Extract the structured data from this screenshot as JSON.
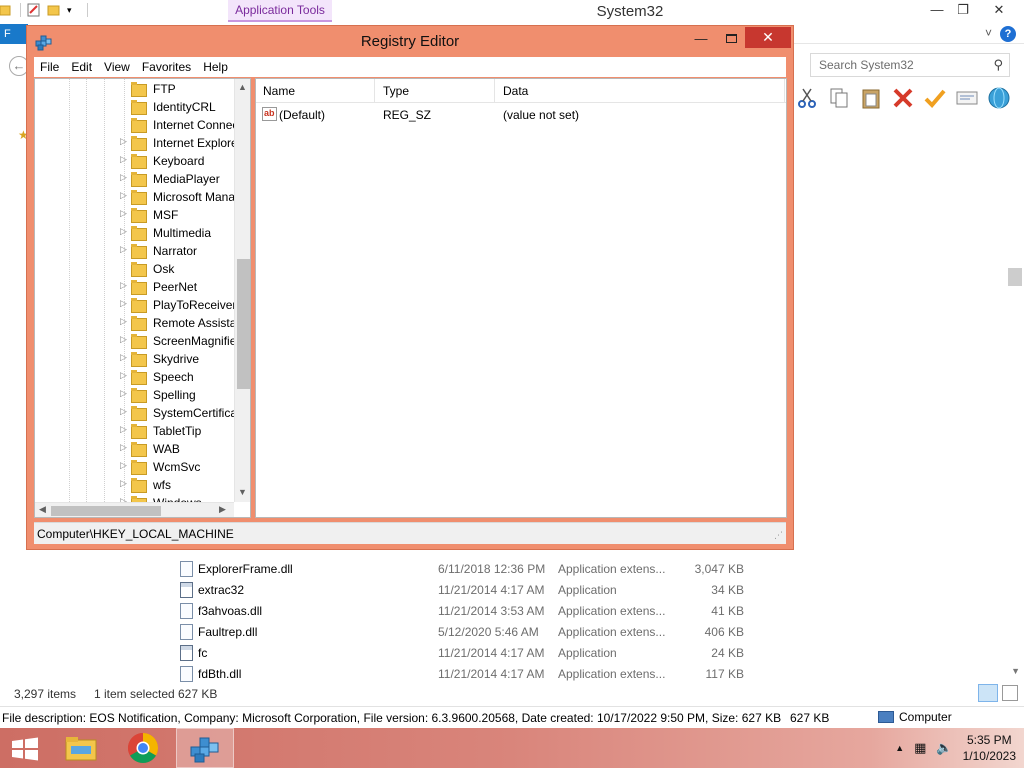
{
  "explorer": {
    "title": "System32",
    "app_tools_tab": "Application Tools",
    "file_tab": "F",
    "search_placeholder": "Search System32",
    "file_rows": [
      {
        "name": "ExplorerFrame.dll",
        "date": "6/11/2018 12:36 PM",
        "type": "Application extens...",
        "size": "3,047 KB",
        "icon": "dll-icon"
      },
      {
        "name": "extrac32",
        "date": "11/21/2014 4:17 AM",
        "type": "Application",
        "size": "34 KB",
        "icon": "app-icon"
      },
      {
        "name": "f3ahvoas.dll",
        "date": "11/21/2014 3:53 AM",
        "type": "Application extens...",
        "size": "41 KB",
        "icon": "dll-icon"
      },
      {
        "name": "Faultrep.dll",
        "date": "5/12/2020 5:46 AM",
        "type": "Application extens...",
        "size": "406 KB",
        "icon": "dll-icon"
      },
      {
        "name": "fc",
        "date": "11/21/2014 4:17 AM",
        "type": "Application",
        "size": "24 KB",
        "icon": "app-icon"
      },
      {
        "name": "fdBth.dll",
        "date": "11/21/2014 4:17 AM",
        "type": "Application extens...",
        "size": "117 KB",
        "icon": "dll-icon"
      }
    ],
    "status": {
      "items_count": "3,297 items",
      "selected": "1 item selected",
      "selected_size": "627 KB"
    },
    "details": {
      "description": "File description: EOS Notification, Company: Microsoft Corporation, File version: 6.3.9600.20568, Date created: 10/17/2022 9:50 PM, Size: 627 KB",
      "size": "627 KB",
      "location": "Computer"
    }
  },
  "regedit": {
    "title": "Registry Editor",
    "menu": [
      "File",
      "Edit",
      "View",
      "Favorites",
      "Help"
    ],
    "tree_items": [
      {
        "label": "FTP",
        "expandable": false
      },
      {
        "label": "IdentityCRL",
        "expandable": false
      },
      {
        "label": "Internet Connectio",
        "expandable": false
      },
      {
        "label": "Internet Explorer",
        "expandable": true
      },
      {
        "label": "Keyboard",
        "expandable": true
      },
      {
        "label": "MediaPlayer",
        "expandable": true
      },
      {
        "label": "Microsoft Manage",
        "expandable": true
      },
      {
        "label": "MSF",
        "expandable": true
      },
      {
        "label": "Multimedia",
        "expandable": true
      },
      {
        "label": "Narrator",
        "expandable": true
      },
      {
        "label": "Osk",
        "expandable": false
      },
      {
        "label": "PeerNet",
        "expandable": true
      },
      {
        "label": "PlayToReceiver",
        "expandable": true
      },
      {
        "label": "Remote Assistance",
        "expandable": true
      },
      {
        "label": "ScreenMagnifier",
        "expandable": true
      },
      {
        "label": "Skydrive",
        "expandable": true
      },
      {
        "label": "Speech",
        "expandable": true
      },
      {
        "label": "Spelling",
        "expandable": true
      },
      {
        "label": "SystemCertificates",
        "expandable": true
      },
      {
        "label": "TabletTip",
        "expandable": true
      },
      {
        "label": "WAB",
        "expandable": true
      },
      {
        "label": "WcmSvc",
        "expandable": true
      },
      {
        "label": "wfs",
        "expandable": true
      },
      {
        "label": "Windows",
        "expandable": true
      }
    ],
    "columns": {
      "name": "Name",
      "type": "Type",
      "data": "Data"
    },
    "values": [
      {
        "name": "(Default)",
        "type": "REG_SZ",
        "data": "(value not set)"
      }
    ],
    "status_path": "Computer\\HKEY_LOCAL_MACHINE"
  },
  "taskbar": {
    "apps": [
      "file-explorer-icon",
      "chrome-icon",
      "regedit-icon"
    ],
    "time": "5:35 PM",
    "date": "1/10/2023"
  }
}
